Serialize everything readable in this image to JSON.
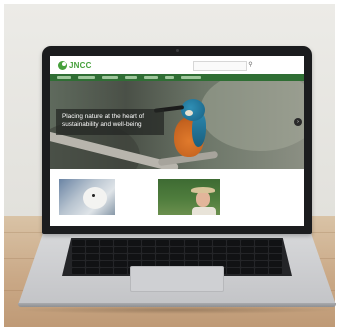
{
  "site": {
    "logo_text": "JNCC",
    "brand_color": "#46a03c",
    "nav_color": "#2f6e34",
    "nav_item_count": 8,
    "search_icon": "search-icon"
  },
  "hero": {
    "caption": "Placing nature at the heart of sustainability and well-being",
    "arrow_icon": "chevron-right-icon"
  },
  "cards": [
    {
      "subject": "seal"
    },
    {
      "subject": "person"
    }
  ]
}
